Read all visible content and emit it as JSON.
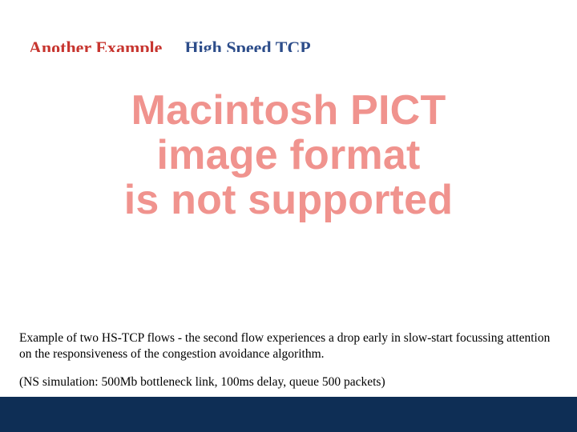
{
  "title": {
    "left": "Another Example",
    "right": "High Speed TCP"
  },
  "pict_error": {
    "line1": "Macintosh PICT",
    "line2": "image format",
    "line3": "is not supported"
  },
  "caption": {
    "para1": "Example of two HS-TCP flows - the second flow experiences a drop early in slow-start focussing attention on the responsiveness of the congestion avoidance algorithm.",
    "para2": "(NS simulation: 500Mb bottleneck link, 100ms delay, queue 500 packets)"
  }
}
